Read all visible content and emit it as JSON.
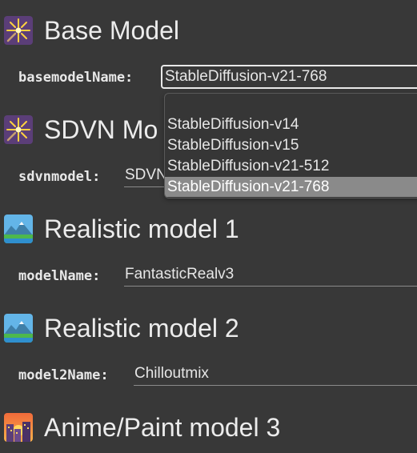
{
  "sections": [
    {
      "title": "Base Model",
      "icon": "sparkler-icon",
      "field_label": "basemodelName:",
      "field_value": "StableDiffusion-v21-768"
    },
    {
      "title": "SDVN Mo",
      "icon": "sparkler-icon",
      "field_label": "sdvnmodel:",
      "field_value": "SDVN"
    },
    {
      "title": "Realistic model 1",
      "icon": "landscape-icon",
      "field_label": "modelName:",
      "field_value": "FantasticRealv3"
    },
    {
      "title": "Realistic model 2",
      "icon": "landscape-icon",
      "field_label": "model2Name:",
      "field_value": "Chilloutmix"
    },
    {
      "title": "Anime/Paint model 3",
      "icon": "night-city-icon"
    }
  ],
  "dropdown": {
    "options": [
      "StableDiffusion-v14",
      "StableDiffusion-v15",
      "StableDiffusion-v21-512",
      "StableDiffusion-v21-768"
    ],
    "selected": "StableDiffusion-v21-768"
  },
  "colors": {
    "background": "#383838",
    "text": "#e6e6e6",
    "selected_option_bg": "#8a8a8a",
    "icon_purple": "#5b3e78"
  }
}
